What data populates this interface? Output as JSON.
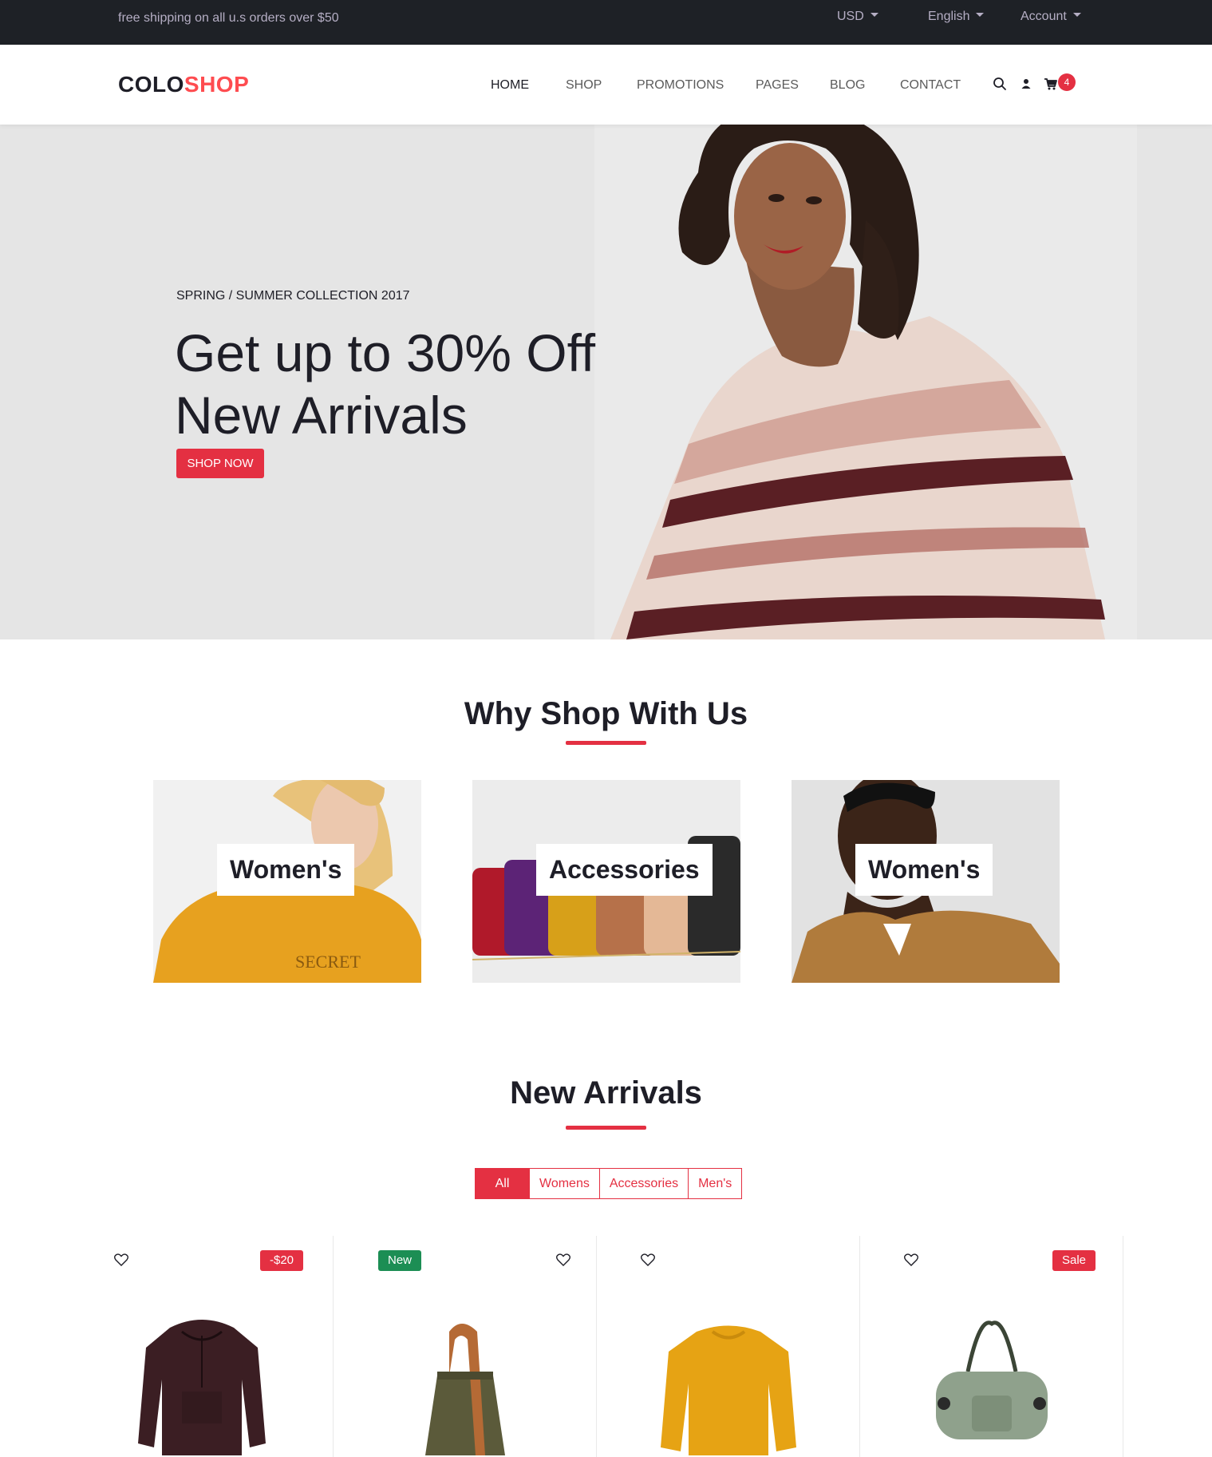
{
  "topbar": {
    "promo": "free shipping on all u.s orders over $50",
    "currency": "USD",
    "language": "English",
    "account": "Account"
  },
  "header": {
    "logo_part1": "COLO",
    "logo_part2": "SHOP",
    "nav": [
      "HOME",
      "SHOP",
      "PROMOTIONS",
      "PAGES",
      "BLOG",
      "CONTACT"
    ],
    "cart_count": "4"
  },
  "hero": {
    "subtitle": "SPRING / SUMMER COLLECTION 2017",
    "title_line1": "Get up to 30% Off",
    "title_line2": "New Arrivals",
    "button": "SHOP NOW"
  },
  "why": {
    "title": "Why Shop With Us",
    "banners": [
      "Women's",
      "Accessories",
      "Women's"
    ]
  },
  "arrivals": {
    "title": "New Arrivals",
    "filters": [
      "All",
      "Womens",
      "Accessories",
      "Men's"
    ],
    "products": [
      {
        "label": "-$20",
        "label_color": "#e43042"
      },
      {
        "label": "New",
        "label_color": "#1c8e54"
      },
      {
        "label": "",
        "label_color": ""
      },
      {
        "label": "Sale",
        "label_color": "#e43042"
      }
    ]
  },
  "colors": {
    "accent": "#e43042",
    "dark": "#1e2126",
    "new_badge": "#1c8e54"
  }
}
